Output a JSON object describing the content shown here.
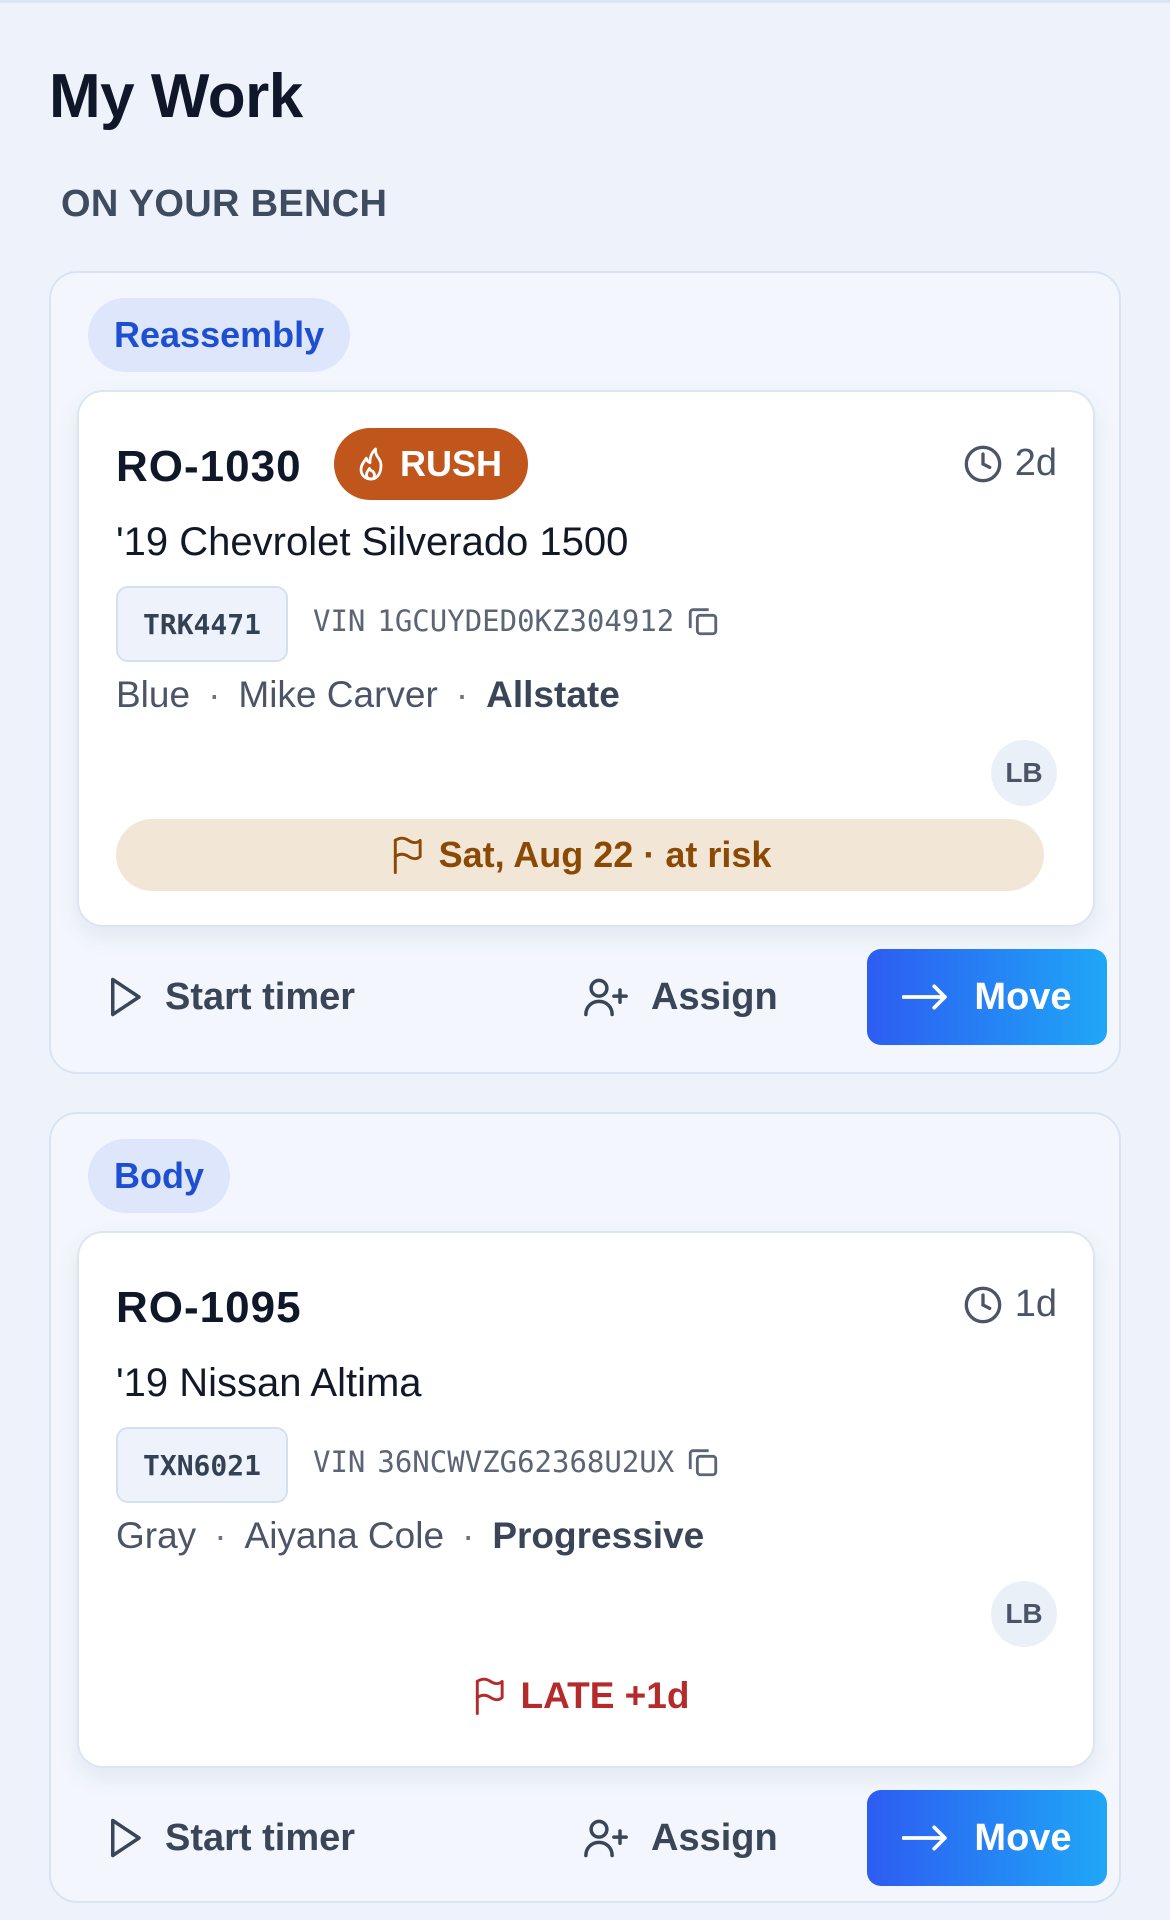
{
  "page": {
    "title": "My Work",
    "section_label": "ON YOUR BENCH"
  },
  "colors": {
    "accent": "#2d5cf2",
    "rush": "#c0561c",
    "at_risk_bg": "#f2e7d6",
    "at_risk_text": "#8a4a06",
    "late": "#b52a2a",
    "stage_pill_bg": "#dde6fb",
    "stage_pill_text": "#1f4fd1"
  },
  "groups": [
    {
      "stage": "Reassembly",
      "card": {
        "ro": "RO-1030",
        "rush_label": "RUSH",
        "age": "2d",
        "vehicle": "'19 Chevrolet Silverado 1500",
        "plate": "TRK4471",
        "vin_label": "VIN",
        "vin": "1GCUYDED0KZ304912",
        "color": "Blue",
        "customer": "Mike Carver",
        "insurer": "Allstate",
        "assignee_initials": "LB",
        "due": "Sat, Aug 22 · at risk"
      },
      "actions": {
        "timer": "Start timer",
        "assign": "Assign",
        "move": "Move"
      }
    },
    {
      "stage": "Body",
      "card": {
        "ro": "RO-1095",
        "age": "1d",
        "vehicle": "'19 Nissan Altima",
        "plate": "TXN6021",
        "vin_label": "VIN",
        "vin": "36NCWVZG62368U2UX",
        "color": "Gray",
        "customer": "Aiyana Cole",
        "insurer": "Progressive",
        "assignee_initials": "LB",
        "status": "LATE +1d"
      },
      "actions": {
        "timer": "Start timer",
        "assign": "Assign",
        "move": "Move"
      }
    }
  ],
  "icons": {
    "rush": "flame-icon",
    "age": "clock-icon",
    "copy": "copy-icon",
    "due": "flag-icon",
    "timer": "play-icon",
    "assign": "user-plus-icon",
    "move": "arrow-right-icon"
  }
}
